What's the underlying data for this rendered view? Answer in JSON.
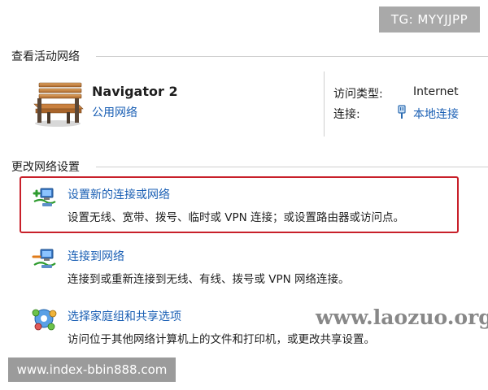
{
  "watermarks": {
    "tg": "TG: MYYJJPP",
    "site": "www.laozuo.org",
    "url": "www.index-bbin888.com"
  },
  "active_networks": {
    "section_title": "查看活动网络",
    "network_name": "Navigator  2",
    "network_type_link": "公用网络",
    "access_type_label": "访问类型:",
    "access_type_value": "Internet",
    "connection_label": "连接:",
    "connection_value": "本地连接"
  },
  "change_settings": {
    "section_title": "更改网络设置",
    "items": [
      {
        "title": "设置新的连接或网络",
        "description": "设置无线、宽带、拨号、临时或 VPN 连接；或设置路由器或访问点。"
      },
      {
        "title": "连接到网络",
        "description": "连接到或重新连接到无线、有线、拨号或 VPN 网络连接。"
      },
      {
        "title": "选择家庭组和共享选项",
        "description": "访问位于其他网络计算机上的文件和打印机，或更改共享设置。"
      }
    ]
  }
}
